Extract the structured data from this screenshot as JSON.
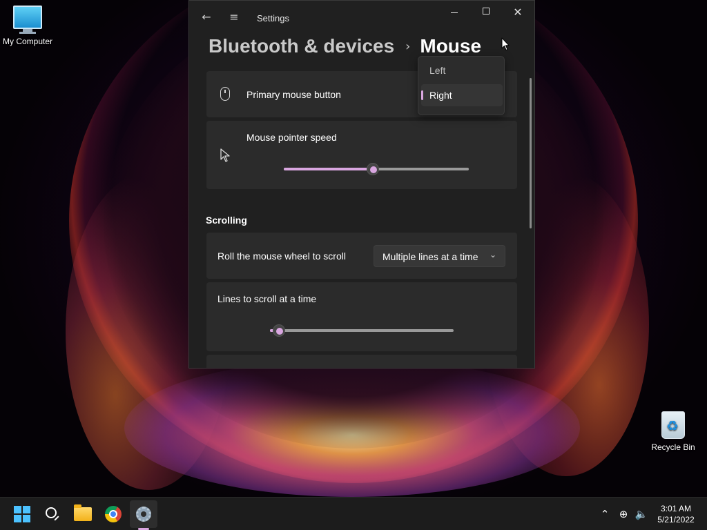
{
  "desktop": {
    "icons": [
      {
        "label": "My Computer",
        "icon": "monitor-icon"
      },
      {
        "label": "Recycle Bin",
        "icon": "recycle-bin-icon"
      }
    ]
  },
  "window": {
    "title": "Settings",
    "breadcrumb": {
      "parent": "Bluetooth & devices",
      "separator": "›",
      "current": "Mouse"
    },
    "primary_button": {
      "label": "Primary mouse button",
      "options": [
        "Left",
        "Right"
      ],
      "selected": "Right"
    },
    "pointer_speed": {
      "label": "Mouse pointer speed",
      "value_fraction": 0.48
    },
    "scrolling": {
      "heading": "Scrolling",
      "roll": {
        "label": "Roll the mouse wheel to scroll",
        "value": "Multiple lines at a time"
      },
      "lines": {
        "label": "Lines to scroll at a time",
        "value_fraction": 0.05
      }
    }
  },
  "taskbar": {
    "pinned": [
      "start-icon",
      "search-icon",
      "file-explorer-icon",
      "chrome-icon",
      "settings-icon"
    ],
    "active": "settings-icon",
    "time": "3:01 AM",
    "date": "5/21/2022"
  },
  "colors": {
    "accent": "#d9a6e0",
    "window_bg": "#202020",
    "card_bg": "#2b2b2b",
    "taskbar_bg": "#1c1c1c"
  }
}
